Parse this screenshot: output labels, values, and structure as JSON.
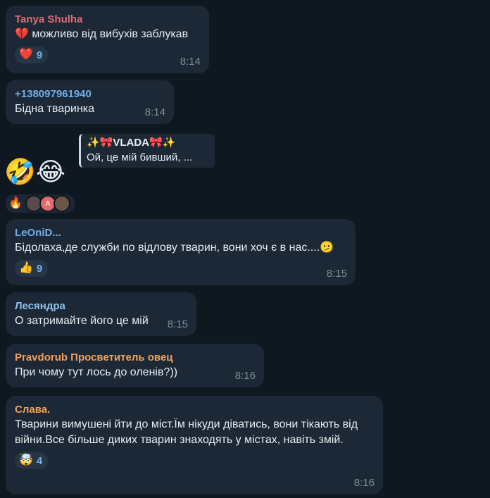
{
  "messages": [
    {
      "author": "Tanya Shulha",
      "author_color": "#e06c75",
      "text": "💔 можливо від вибухів заблукав",
      "reaction_emoji": "❤️",
      "reaction_count": "9",
      "time": "8:14"
    },
    {
      "author": "+138097961940",
      "author_color": "#6fb0ea",
      "text": "Бідна тваринка",
      "time": "8:14"
    },
    {
      "reply_author": "✨🎀VLADA🎀✨",
      "reply_text": "Ой, це мій бивший, ...",
      "stickers": "🤣😂",
      "reactions": {
        "emoji": "🔥",
        "avatars": [
          "A"
        ]
      }
    },
    {
      "author": "LeOniD...",
      "author_color": "#6fb0ea",
      "text": "Бідолаха,де служби по відлову тварин, вони хоч є в нас....🫤",
      "reaction_emoji": "👍",
      "reaction_count": "9",
      "time": "8:15"
    },
    {
      "author": "Лесяндра",
      "author_color": "#8fc3f0",
      "text": "О затримайте його це мій",
      "time": "8:15"
    },
    {
      "author": "Pravdorub Просветитель овец",
      "author_color": "#f2a05a",
      "text": "При чому тут лось до оленів?))",
      "time": "8:16"
    },
    {
      "author": "Слава.",
      "author_color": "#f2a05a",
      "text": "Тварини вимушені йти до міст.Їм нікуди діватись, вони тікають від війни.Все більше диких тварин знаходять у містах, навіть змій.",
      "reaction_emoji": "🤯",
      "reaction_count": "4",
      "time": "8:16"
    }
  ]
}
